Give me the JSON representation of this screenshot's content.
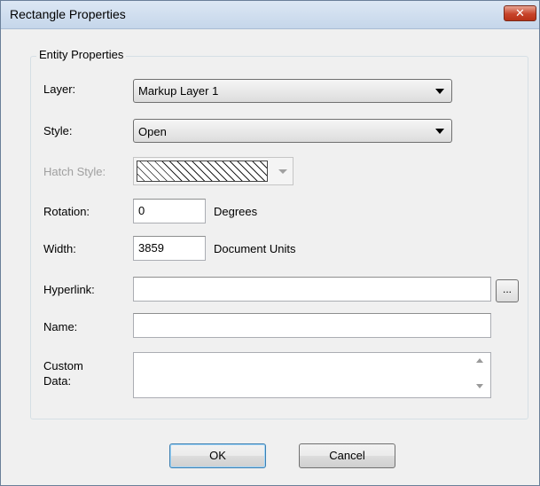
{
  "window": {
    "title": "Rectangle Properties",
    "close_glyph": "✕"
  },
  "group": {
    "legend": "Entity Properties"
  },
  "layer": {
    "label": "Layer:",
    "value": "Markup Layer 1"
  },
  "style": {
    "label": "Style:",
    "value": "Open"
  },
  "hatch": {
    "label": "Hatch Style:"
  },
  "rotation": {
    "label": "Rotation:",
    "value": "0",
    "unit": "Degrees"
  },
  "width": {
    "label": "Width:",
    "value": "3859",
    "unit": "Document Units"
  },
  "hyperlink": {
    "label": "Hyperlink:",
    "value": "",
    "browse_label": "..."
  },
  "name": {
    "label": "Name:",
    "value": ""
  },
  "custom_data": {
    "label_line1": "Custom",
    "label_line2": "Data:",
    "value": ""
  },
  "buttons": {
    "ok": "OK",
    "cancel": "Cancel"
  }
}
